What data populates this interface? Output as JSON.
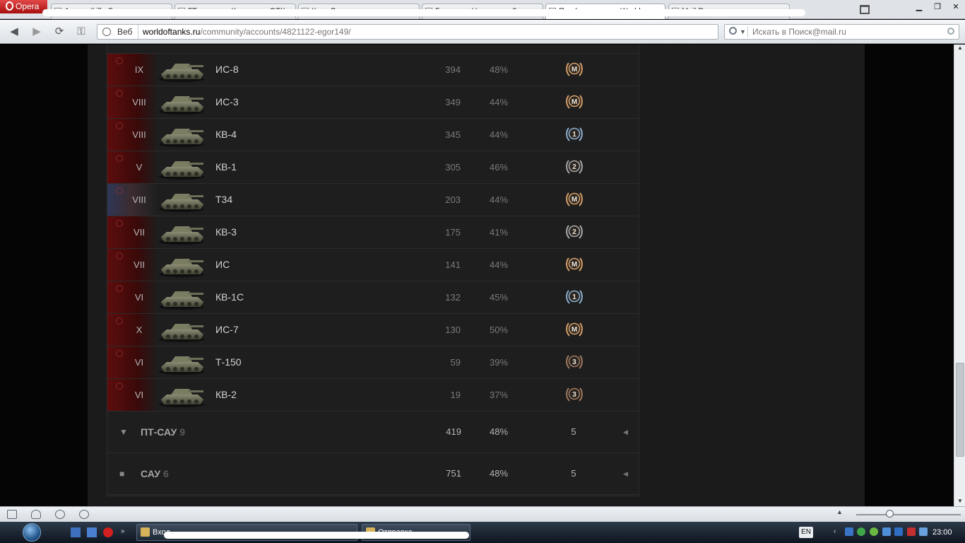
{
  "browser": {
    "app_name": "Opera",
    "url_prefix": "Веб",
    "url_domain": "worldoftanks.ru",
    "url_path": "/community/accounts/4821122-egor149/",
    "search_placeholder": "Искать в Поиск@mail.ru",
    "tabs": [
      {
        "label": "Accountkill - Главная"
      },
      {
        "label": "ГТорознову Кошелек - ОТК"
      },
      {
        "label": "Кто - Видеоклипы"
      },
      {
        "label": "Главная - Нагорнера 2"
      },
      {
        "label": "Профиль игрока World"
      },
      {
        "label": "Mail.Ru: почта, поиск"
      }
    ]
  },
  "vehicles": [
    {
      "flag": "ussr",
      "tier": "IX",
      "name": "ИС-8",
      "battles": "394",
      "wins": "48%",
      "mastery": "M",
      "mastery_color": "#d7a06a"
    },
    {
      "flag": "ussr",
      "tier": "VIII",
      "name": "ИС-3",
      "battles": "349",
      "wins": "44%",
      "mastery": "M",
      "mastery_color": "#d7a06a"
    },
    {
      "flag": "ussr",
      "tier": "VIII",
      "name": "КВ-4",
      "battles": "345",
      "wins": "44%",
      "mastery": "1",
      "mastery_color": "#8eb0cf"
    },
    {
      "flag": "ussr",
      "tier": "V",
      "name": "КВ-1",
      "battles": "305",
      "wins": "46%",
      "mastery": "2",
      "mastery_color": "#a9a9a9"
    },
    {
      "flag": "usa",
      "tier": "VIII",
      "name": "T34",
      "battles": "203",
      "wins": "44%",
      "mastery": "M",
      "mastery_color": "#d7a06a"
    },
    {
      "flag": "ussr",
      "tier": "VII",
      "name": "КВ-3",
      "battles": "175",
      "wins": "41%",
      "mastery": "2",
      "mastery_color": "#a9a9a9"
    },
    {
      "flag": "ussr",
      "tier": "VII",
      "name": "ИС",
      "battles": "141",
      "wins": "44%",
      "mastery": "M",
      "mastery_color": "#d7a06a"
    },
    {
      "flag": "ussr",
      "tier": "VI",
      "name": "КВ-1С",
      "battles": "132",
      "wins": "45%",
      "mastery": "1",
      "mastery_color": "#8eb0cf"
    },
    {
      "flag": "ussr",
      "tier": "X",
      "name": "ИС-7",
      "battles": "130",
      "wins": "50%",
      "mastery": "M",
      "mastery_color": "#d7a06a"
    },
    {
      "flag": "ussr",
      "tier": "VI",
      "name": "Т-150",
      "battles": "59",
      "wins": "39%",
      "mastery": "3",
      "mastery_color": "#a07a60"
    },
    {
      "flag": "ussr",
      "tier": "VI",
      "name": "КВ-2",
      "battles": "19",
      "wins": "37%",
      "mastery": "3",
      "mastery_color": "#a07a60"
    }
  ],
  "groups": [
    {
      "name": "ПТ-САУ",
      "count": "9",
      "battles": "419",
      "wins": "48%",
      "mastery_count": "5",
      "marker": "▼"
    },
    {
      "name": "САУ",
      "count": "6",
      "battles": "751",
      "wins": "48%",
      "mastery_count": "5",
      "marker": "■"
    }
  ],
  "taskbar": {
    "items": [
      {
        "label": "Вход — ..."
      },
      {
        "label": "Отправка..."
      }
    ],
    "language": "EN",
    "clock": "23:00"
  }
}
